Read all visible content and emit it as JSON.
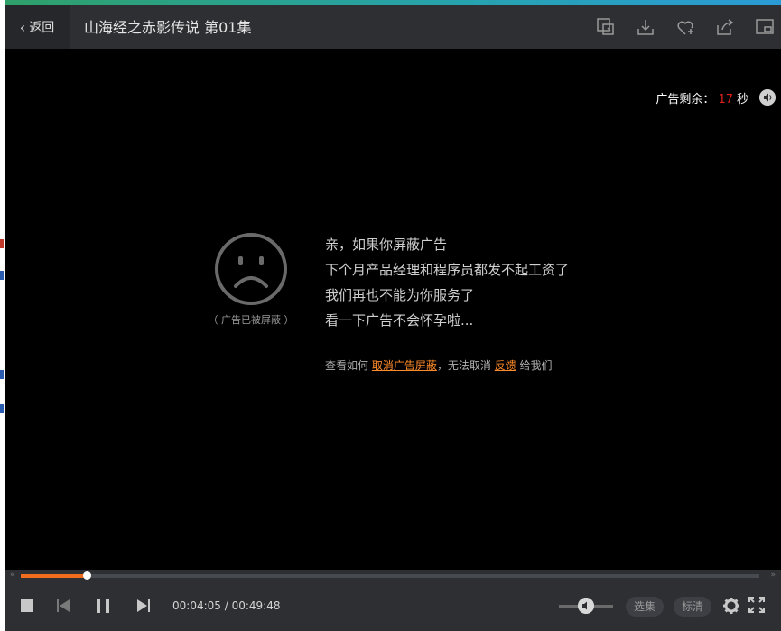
{
  "header": {
    "back_label": "返回",
    "title": "山海经之赤影传说 第01集",
    "toolbar_icons": [
      "screenshot-icon",
      "download-icon",
      "favorite-add-icon",
      "share-icon",
      "mini-window-icon"
    ]
  },
  "ad": {
    "remain_label": "广告剩余：",
    "remain_seconds": "17",
    "remain_unit": "秒",
    "blocked_label": "（ 广告已被屏蔽 ）",
    "message_lines": [
      "亲，如果你屏蔽广告",
      "下个月产品经理和程序员都发不起工资了",
      "我们再也不能为你服务了",
      "看一下广告不会怀孕啦..."
    ],
    "hint_prefix": "查看如何",
    "hint_link_unblock": "取消广告屏蔽",
    "hint_middle": "，无法取消",
    "hint_link_feedback": "反馈",
    "hint_suffix": "给我们"
  },
  "player": {
    "current_time": "00:04:05",
    "time_separator": " / ",
    "total_time": "00:49:48",
    "progress_fraction": 0.089,
    "volume_fraction": 0.5,
    "episodes_label": "选集",
    "quality_label": "标清"
  },
  "colors": {
    "accent": "#f06d1e",
    "countdown": "#e0201f",
    "link": "#ff8a2a",
    "top_line": "#2b9bd6"
  }
}
